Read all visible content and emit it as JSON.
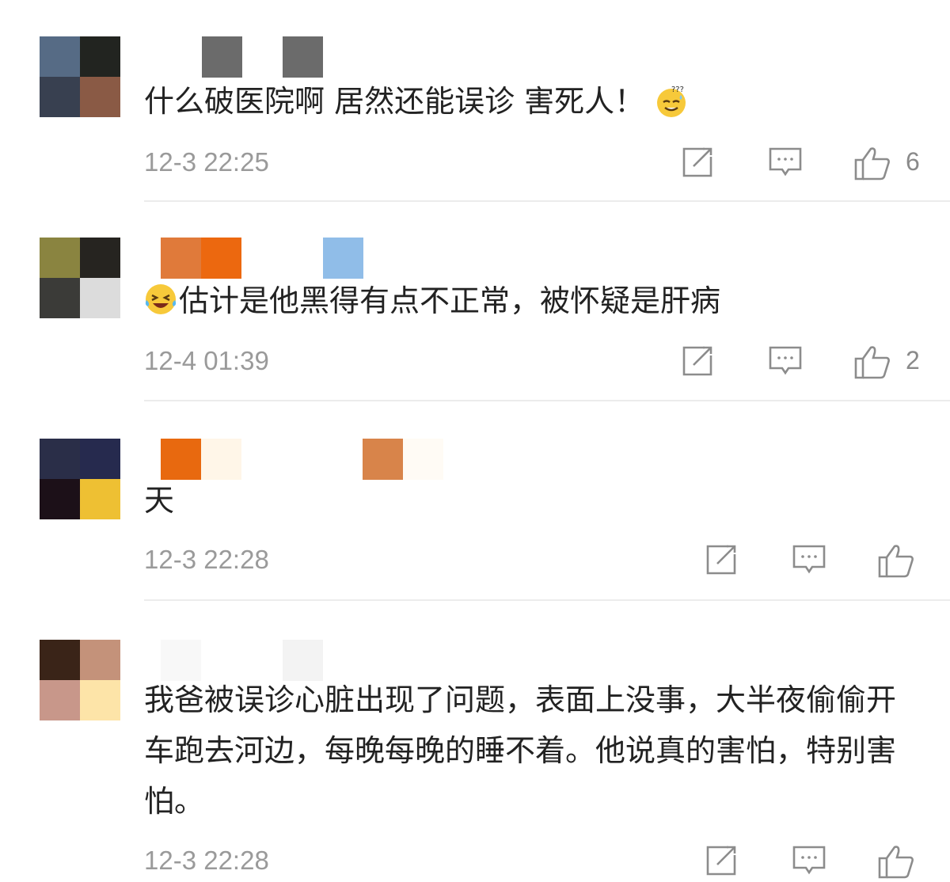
{
  "comments": [
    {
      "avatar_colors": [
        "#566b85",
        "#222420",
        "#384050",
        "#8a5a45"
      ],
      "name_blocks": [
        "#6b6b6b",
        "#6b6b6b"
      ],
      "text": "什么破医院啊 居然还能误诊 害死人！",
      "emoji": "sweat-question-emoji",
      "time": "12-3 22:25",
      "likes": "6"
    },
    {
      "avatar_colors": [
        "#8a8440",
        "#262420",
        "#3b3b38",
        "#dcdcdc"
      ],
      "name_blocks": [
        "#e07a3a",
        "#ec680f",
        "#90bde8"
      ],
      "text": "估计是他黑得有点不正常，被怀疑是肝病",
      "emoji": "laughing-crying-emoji",
      "time": "12-4 01:39",
      "likes": "2"
    },
    {
      "avatar_colors": [
        "#2a2e48",
        "#262a4e",
        "#1c1018",
        "#eec033"
      ],
      "name_blocks": [
        "#e8690f",
        "#fff6e8",
        "#d8844a",
        "#fffbf5"
      ],
      "text": "天",
      "time": "12-3 22:28",
      "likes": ""
    },
    {
      "avatar_colors": [
        "#3a2418",
        "#c4927a",
        "#c8978a",
        "#fde4a8"
      ],
      "name_blocks": [
        "#f8f8f8",
        "#f3f3f3"
      ],
      "text": "我爸被误诊心脏出现了问题，表面上没事，大半夜偷偷开车跑去河边，每晚每晚的睡不着。他说真的害怕，特别害怕。",
      "time": "12-3 22:28",
      "likes": ""
    }
  ],
  "icons": {
    "share": "share-icon",
    "reply": "comment-icon",
    "like": "thumbs-up-icon"
  }
}
